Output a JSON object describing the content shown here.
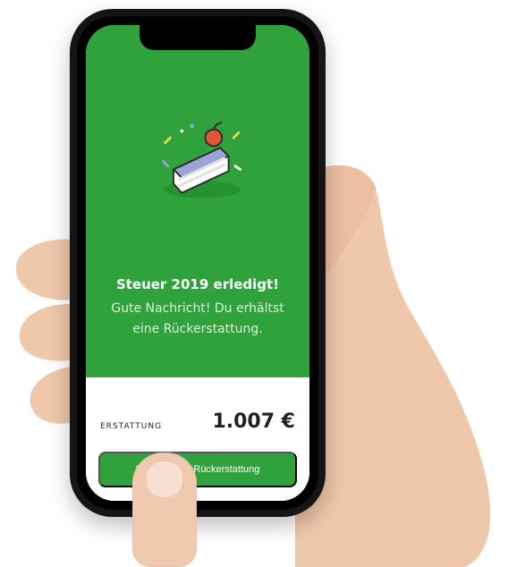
{
  "main": {
    "title": "Steuer 2019 erledigt!",
    "message_line1": "Gute Nachricht! Du erhältst",
    "message_line2": "eine Rückerstattung."
  },
  "summary": {
    "label": "ERSTATTUNG",
    "amount": "1.007 €"
  },
  "cta": {
    "label": "Hol dir deine Rückerstattung"
  },
  "colors": {
    "accent_green": "#2fa23b",
    "accent_text": "#d8f2da"
  },
  "icons": {
    "cake": "cake-slice-icon"
  }
}
